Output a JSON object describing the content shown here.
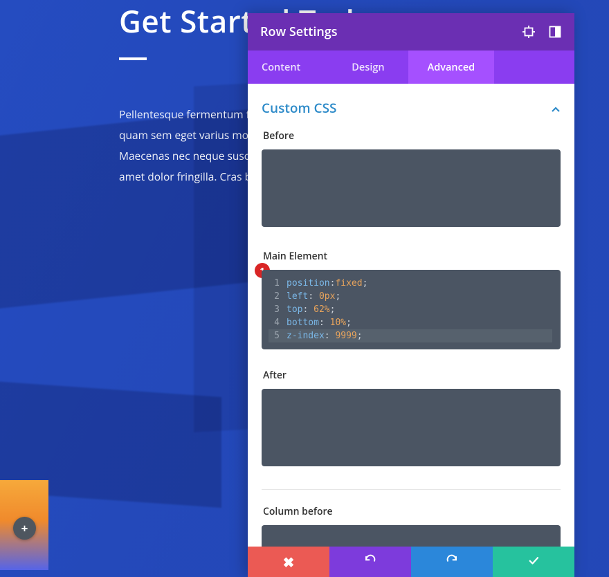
{
  "page": {
    "heading": "Get Started Today",
    "paragraph": "Pellentesque fermentum faucibus odio id venenatis. Vestibulum rhoncus quam sem eget varius mollis. Sed venenatis lectus et felis tincidunt. Maecenas nec neque suscipit neque iaculis, non mattis eleifend. Nunc sit amet dolor fringilla. Cras blandit urna sit amet venenatis eros.",
    "add_button_label": "+"
  },
  "panel": {
    "title": "Row Settings",
    "tabs": {
      "content": "Content",
      "design": "Design",
      "advanced": "Advanced",
      "active": "advanced"
    },
    "section_title": "Custom CSS",
    "fields": {
      "before": {
        "label": "Before",
        "value": ""
      },
      "main": {
        "label": "Main Element"
      },
      "after": {
        "label": "After",
        "value": ""
      },
      "col_before": {
        "label": "Column before",
        "value": ""
      }
    },
    "code": {
      "lines": [
        {
          "n": "1",
          "prop": "position",
          "sep": ":",
          "val": "fixed",
          "end": ";"
        },
        {
          "n": "2",
          "prop": "left",
          "sep": ": ",
          "val": "0px",
          "end": ";"
        },
        {
          "n": "3",
          "prop": "top",
          "sep": ": ",
          "val": "62%",
          "end": ";"
        },
        {
          "n": "4",
          "prop": "bottom",
          "sep": ": ",
          "val": "10%",
          "end": ";"
        },
        {
          "n": "5",
          "prop": "z-index",
          "sep": ": ",
          "val": "9999",
          "end": ";"
        }
      ]
    },
    "annotation": "1"
  }
}
